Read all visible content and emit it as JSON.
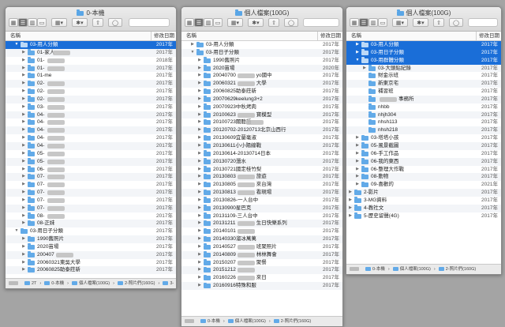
{
  "windows": [
    {
      "title": "0-本機",
      "column_name": "名稱",
      "column_date": "修改日期",
      "path": [
        "2T",
        "0-本機",
        "個人檔案(100G)",
        "2-照片們(160G)",
        "3-"
      ],
      "rows": [
        {
          "name": "03-用人分類",
          "level": 0,
          "tri": "open",
          "selected": true,
          "date": "2017年"
        },
        {
          "name": "01-家人",
          "level": 1,
          "tri": "closed",
          "blur": true,
          "date": "2017年"
        },
        {
          "name": "01-",
          "level": 1,
          "tri": "closed",
          "blur": true,
          "date": "2018年"
        },
        {
          "name": "01-",
          "level": 1,
          "tri": "closed",
          "blur": true,
          "date": "2017年"
        },
        {
          "name": "01-me",
          "level": 1,
          "tri": "closed",
          "date": "2017年"
        },
        {
          "name": "02-",
          "level": 1,
          "tri": "closed",
          "blur": true,
          "date": "2017年"
        },
        {
          "name": "02-",
          "level": 1,
          "tri": "closed",
          "blur": true,
          "date": "2017年"
        },
        {
          "name": "02-",
          "level": 1,
          "tri": "closed",
          "blur": true,
          "date": "2017年"
        },
        {
          "name": "03-",
          "level": 1,
          "tri": "closed",
          "blur": true,
          "date": "2017年"
        },
        {
          "name": "04-",
          "level": 1,
          "tri": "closed",
          "blur": true,
          "date": "2017年"
        },
        {
          "name": "04-",
          "level": 1,
          "tri": "closed",
          "blur": true,
          "date": "2017年"
        },
        {
          "name": "04-",
          "level": 1,
          "tri": "closed",
          "blur": true,
          "date": "2017年"
        },
        {
          "name": "04-",
          "level": 1,
          "tri": "closed",
          "blur": true,
          "date": "2017年"
        },
        {
          "name": "04-",
          "level": 1,
          "tri": "closed",
          "blur": true,
          "date": "2017年"
        },
        {
          "name": "05-",
          "level": 1,
          "tri": "closed",
          "blur": true,
          "date": "2017年"
        },
        {
          "name": "05-",
          "level": 1,
          "tri": "closed",
          "blur": true,
          "date": "2017年"
        },
        {
          "name": "06-",
          "level": 1,
          "tri": "closed",
          "blur": true,
          "date": "2017年"
        },
        {
          "name": "07-",
          "level": 1,
          "tri": "closed",
          "blur": true,
          "date": "2017年"
        },
        {
          "name": "07-",
          "level": 1,
          "tri": "closed",
          "blur": true,
          "date": "2017年"
        },
        {
          "name": "07-",
          "level": 1,
          "tri": "closed",
          "blur": true,
          "date": "2017年"
        },
        {
          "name": "07-",
          "level": 1,
          "tri": "closed",
          "blur": true,
          "date": "2017年"
        },
        {
          "name": "07-",
          "level": 1,
          "tri": "closed",
          "blur": true,
          "date": "2017年"
        },
        {
          "name": "08-",
          "level": 1,
          "tri": "closed",
          "blur": true,
          "date": "2017年"
        },
        {
          "name": "08-正妹",
          "level": 1,
          "tri": "closed",
          "date": "2017年"
        },
        {
          "name": "03-用日子分類",
          "level": 0,
          "tri": "open",
          "date": "2017年"
        },
        {
          "name": "1990舊照片",
          "level": 1,
          "tri": "closed",
          "date": "2017年"
        },
        {
          "name": "2020苗場",
          "level": 1,
          "tri": "closed",
          "date": "2017年"
        },
        {
          "name": "200407",
          "level": 1,
          "tri": "closed",
          "blur": true,
          "date": "2017年"
        },
        {
          "name": "20060321東吳大學",
          "level": 1,
          "tri": "closed",
          "date": "2017年"
        },
        {
          "name": "20060825助泰莊新",
          "level": 1,
          "tri": "closed",
          "date": "2017年"
        }
      ]
    },
    {
      "title": "個人檔案(100G)",
      "column_name": "名稱",
      "column_date": "修改日期",
      "path": [
        "0-本機",
        "個人檔案(100G)",
        "2-照片們(160G)"
      ],
      "rows": [
        {
          "name": "03-用人分類",
          "level": 0,
          "tri": "closed",
          "date": "2017年"
        },
        {
          "name": "03-用日子分類",
          "level": 0,
          "tri": "open",
          "date": "2017年"
        },
        {
          "name": "1990舊照片",
          "level": 1,
          "tri": "closed",
          "date": "2017年"
        },
        {
          "name": "2020苗場",
          "level": 1,
          "tri": "closed",
          "date": "2020年"
        },
        {
          "name": "20040700",
          "level": 1,
          "tri": "closed",
          "blur": true,
          "suffix": "yo國中",
          "date": "2017年"
        },
        {
          "name": "20060321",
          "level": 1,
          "tri": "closed",
          "blur": true,
          "suffix": "大學",
          "date": "2017年"
        },
        {
          "name": "20060825助泰莊新",
          "level": 1,
          "tri": "closed",
          "date": "2017年"
        },
        {
          "name": "20070629keelung3+2",
          "level": 1,
          "tri": "closed",
          "date": "2017年"
        },
        {
          "name": "20070923中秋烤肉",
          "level": 1,
          "tri": "closed",
          "date": "2017年"
        },
        {
          "name": "20100623",
          "level": 1,
          "tri": "closed",
          "blur": true,
          "suffix": "寶模型",
          "date": "2017年"
        },
        {
          "name": "20100723關聽語",
          "level": 1,
          "tri": "closed",
          "blur": true,
          "date": "2017年"
        },
        {
          "name": "20120702-20120713北京山西行",
          "level": 1,
          "tri": "closed",
          "date": "2017年"
        },
        {
          "name": "20130609宜蘭毫淑",
          "level": 1,
          "tri": "closed",
          "date": "2017年"
        },
        {
          "name": "20130611小小陽線戰",
          "level": 1,
          "tri": "closed",
          "date": "2017年"
        },
        {
          "name": "20130614-20130714日本",
          "level": 1,
          "tri": "closed",
          "date": "2017年"
        },
        {
          "name": "20130720潛水",
          "level": 1,
          "tri": "closed",
          "date": "2017年"
        },
        {
          "name": "20130721國定桂竹梨",
          "level": 1,
          "tri": "closed",
          "date": "2017年"
        },
        {
          "name": "20130803",
          "level": 1,
          "tri": "closed",
          "blur": true,
          "suffix": "旅遊",
          "date": "2017年"
        },
        {
          "name": "20130805",
          "level": 1,
          "tri": "closed",
          "blur": true,
          "suffix": "來台灣",
          "date": "2017年"
        },
        {
          "name": "20130813",
          "level": 1,
          "tri": "closed",
          "blur": true,
          "suffix": "看現場",
          "date": "2017年"
        },
        {
          "name": "20130826-一人台中",
          "level": 1,
          "tri": "closed",
          "date": "2017年"
        },
        {
          "name": "20130900星巴克",
          "level": 1,
          "tri": "closed",
          "date": "2017年"
        },
        {
          "name": "20131109-三人台中",
          "level": 1,
          "tri": "closed",
          "date": "2017年"
        },
        {
          "name": "20131211",
          "level": 1,
          "tri": "closed",
          "blur": true,
          "suffix": "生日快樂系列",
          "date": "2017年"
        },
        {
          "name": "20140101",
          "level": 1,
          "tri": "closed",
          "blur": true,
          "date": "2017年"
        },
        {
          "name": "20140330溜冰萬萬",
          "level": 1,
          "tri": "closed",
          "date": "2017年"
        },
        {
          "name": "20140527",
          "level": 1,
          "tri": "closed",
          "blur": true,
          "suffix": "班聚照片",
          "date": "2017年"
        },
        {
          "name": "20140809",
          "level": 1,
          "tri": "closed",
          "blur": true,
          "suffix": "林林舞會",
          "date": "2017年"
        },
        {
          "name": "20150207",
          "level": 1,
          "tri": "closed",
          "blur": true,
          "suffix": "聚餐",
          "date": "2017年"
        },
        {
          "name": "20151212",
          "level": 1,
          "tri": "closed",
          "blur": true,
          "date": "2017年"
        },
        {
          "name": "20160226",
          "level": 1,
          "tri": "closed",
          "blur": true,
          "suffix": "來日",
          "date": "2017年"
        },
        {
          "name": "20160916特殊和服",
          "level": 1,
          "tri": "closed",
          "date": "2017年"
        }
      ]
    },
    {
      "title": "個人檔案(100G)",
      "column_name": "名稱",
      "column_date": "修改日期",
      "path": [
        "0-本機",
        "個人檔案(100G)",
        "2-照片們(160G)"
      ],
      "rows": [
        {
          "name": "03-用人分類",
          "level": 0,
          "tri": "closed",
          "selected": true,
          "date": "2017年"
        },
        {
          "name": "03-用日子分類",
          "level": 0,
          "tri": "closed",
          "selected": true,
          "date": "2017年"
        },
        {
          "name": "03-用群體分類",
          "level": 0,
          "tri": "open",
          "selected": true,
          "date": "2017年"
        },
        {
          "name": "03-大頭貼紀錄",
          "level": 1,
          "tri": "closed",
          "date": "2017年"
        },
        {
          "name": "財金示班",
          "level": 1,
          "tri": "none",
          "date": "2017年"
        },
        {
          "name": "新東京宅",
          "level": 1,
          "tri": "none",
          "date": "2017年"
        },
        {
          "name": "補習班",
          "level": 1,
          "tri": "none",
          "date": "2017年"
        },
        {
          "name": "",
          "level": 1,
          "tri": "none",
          "blur": true,
          "suffix": "事務所",
          "date": "2017年"
        },
        {
          "name": "nhbb",
          "level": 1,
          "tri": "none",
          "date": "2017年"
        },
        {
          "name": "nhjh304",
          "level": 1,
          "tri": "none",
          "date": "2017年"
        },
        {
          "name": "nhsh113",
          "level": 1,
          "tri": "none",
          "date": "2017年"
        },
        {
          "name": "nhsh218",
          "level": 1,
          "tri": "none",
          "date": "2017年"
        },
        {
          "name": "03-塔塔小孩",
          "level": 0,
          "tri": "closed",
          "date": "2017年"
        },
        {
          "name": "05-風景截圖",
          "level": 0,
          "tri": "closed",
          "date": "2017年"
        },
        {
          "name": "06-手工作品",
          "level": 0,
          "tri": "closed",
          "date": "2017年"
        },
        {
          "name": "06-我的東西",
          "level": 0,
          "tri": "closed",
          "date": "2017年"
        },
        {
          "name": "06-整理大作戰",
          "level": 0,
          "tri": "closed",
          "date": "2017年"
        },
        {
          "name": "08-動物",
          "level": 0,
          "tri": "closed",
          "date": "2017年"
        },
        {
          "name": "09-喜歡的",
          "level": 0,
          "tri": "closed",
          "date": "2021年"
        },
        {
          "name": "2-影片",
          "level": -1,
          "tri": "closed",
          "date": "2017年"
        },
        {
          "name": "3-MG資料",
          "level": -1,
          "tri": "closed",
          "date": "2017年"
        },
        {
          "name": "4-教社文",
          "level": -1,
          "tri": "closed",
          "date": "2017年"
        },
        {
          "name": "5-歷史留聲(4G)",
          "level": -1,
          "tri": "closed",
          "date": "2017年"
        }
      ]
    }
  ]
}
